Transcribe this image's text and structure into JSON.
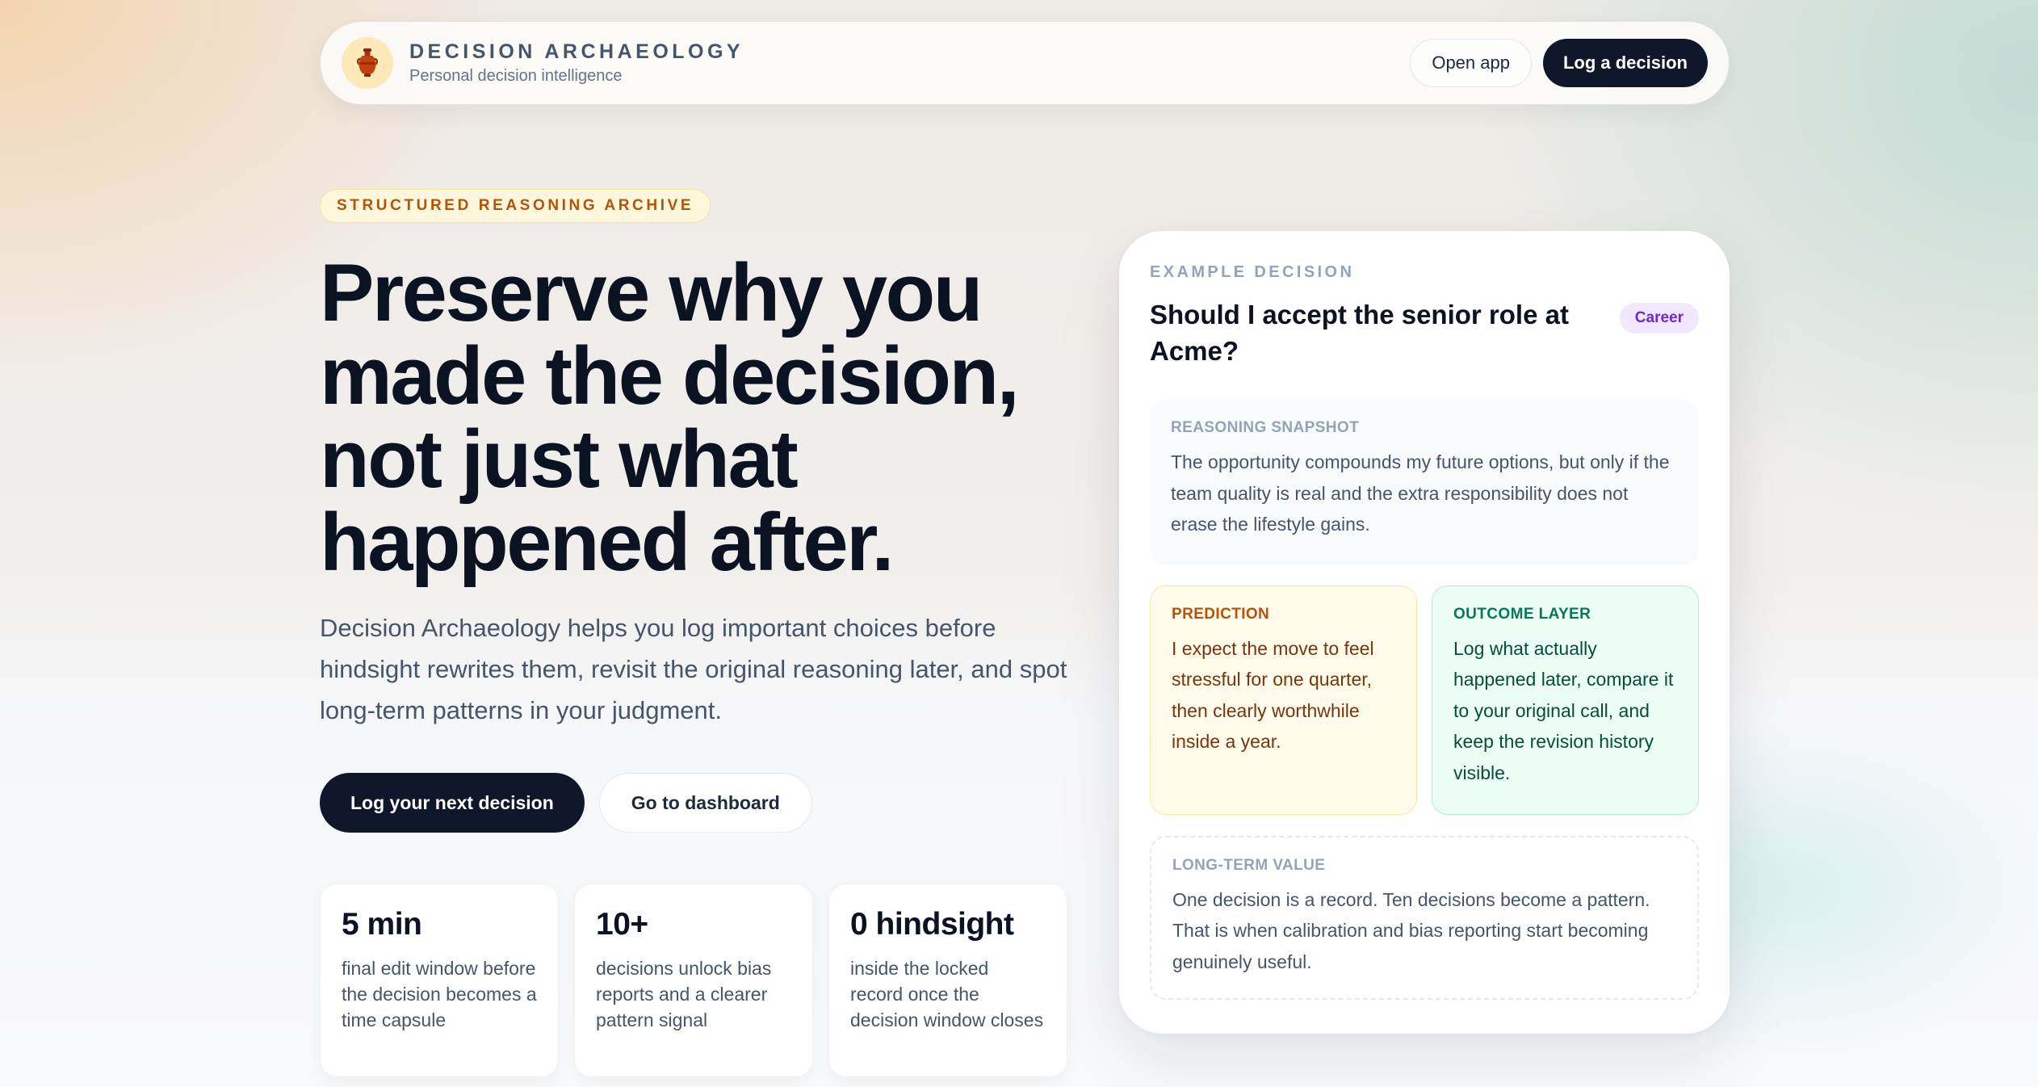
{
  "nav": {
    "brand_title": "DECISION ARCHAEOLOGY",
    "brand_subtitle": "Personal decision intelligence",
    "logo_icon": "amphora-icon",
    "open_app_label": "Open app",
    "log_decision_label": "Log a decision"
  },
  "hero": {
    "eyebrow": "STRUCTURED REASONING ARCHIVE",
    "headline": "Preserve why you made the decision, not just what happened after.",
    "lede": "Decision Archaeology helps you log important choices before hindsight rewrites them, revisit the original reasoning later, and spot long-term patterns in your judgment.",
    "primary_cta": "Log your next decision",
    "secondary_cta": "Go to dashboard"
  },
  "stats": [
    {
      "value": "5 min",
      "description": "final edit window before the decision becomes a time capsule"
    },
    {
      "value": "10+",
      "description": "decisions unlock bias reports and a clearer pattern signal"
    },
    {
      "value": "0 hindsight",
      "description": "inside the locked record once the decision window closes"
    }
  ],
  "example": {
    "eyebrow": "EXAMPLE DECISION",
    "title": "Should I accept the senior role at Acme?",
    "tag": "Career",
    "snapshot_label": "REASONING SNAPSHOT",
    "snapshot_text": "The opportunity compounds my future options, but only if the team quality is real and the extra responsibility does not erase the lifestyle gains.",
    "prediction_label": "PREDICTION",
    "prediction_text": "I expect the move to feel stressful for one quarter, then clearly worthwhile inside a year.",
    "outcome_label": "OUTCOME LAYER",
    "outcome_text": "Log what actually happened later, compare it to your original call, and keep the revision history visible.",
    "longterm_label": "LONG-TERM VALUE",
    "longterm_text": "One decision is a record. Ten decisions become a pattern. That is when calibration and bias reporting start becoming genuinely useful."
  },
  "colors": {
    "primary_dark": "#0f172a",
    "eyebrow_accent": "#b45309",
    "tag_purple": "#6d28d9",
    "outcome_green": "#047857"
  }
}
